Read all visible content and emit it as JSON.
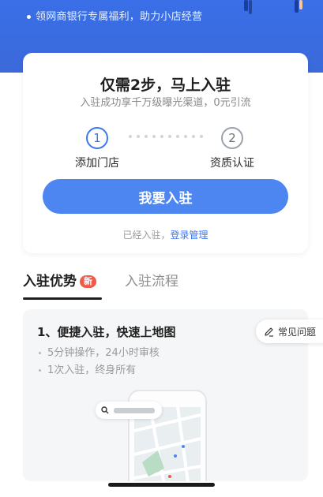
{
  "banner": {
    "benefit_text": "领网商银行专属福利，助力小店经营"
  },
  "signup_card": {
    "headline": "仅需2步，马上入驻",
    "subline": "入驻成功享千万级曝光渠道，0元引流",
    "steps": [
      {
        "number": "1",
        "label": "添加门店"
      },
      {
        "number": "2",
        "label": "资质认证"
      }
    ],
    "cta_label": "我要入驻",
    "already_joined_text": "已经入驻，",
    "login_link": "登录管理"
  },
  "tabs": {
    "items": [
      {
        "label": "入驻优势",
        "badge": "新",
        "active": true
      },
      {
        "label": "入驻流程",
        "active": false
      }
    ]
  },
  "advantage": {
    "title": "1、便捷入驻，快速上地图",
    "points": [
      "5分钟操作，24小时审核",
      "1次入驻，终身所有"
    ]
  },
  "faq": {
    "label": "常见问题"
  },
  "colors": {
    "brand_blue": "#4d86f0",
    "banner_blue": "#3a6fe8",
    "badge_red": "#ef5a4a"
  },
  "icons": {
    "faq": "pencil-icon",
    "search": "search-icon"
  }
}
